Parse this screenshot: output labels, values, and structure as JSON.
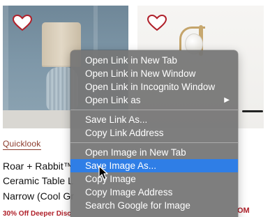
{
  "products": {
    "left": {
      "quicklook": "Quicklook",
      "title_lines": [
        "Roar + Rabbit™",
        "Ceramic Table L",
        "Narrow (Cool Gr"
      ],
      "promo": "30% Off Deeper Disc"
    },
    "right": {
      "promo_tail": "OM"
    }
  },
  "icons": {
    "left_favorite": "heart-icon",
    "right_favorite": "heart-icon",
    "submenu": "chevron-right-icon",
    "pointer": "arrow-cursor-icon"
  },
  "context_menu": {
    "groups": [
      {
        "items": [
          {
            "label": "Open Link in New Tab"
          },
          {
            "label": "Open Link in New Window"
          },
          {
            "label": "Open Link in Incognito Window"
          },
          {
            "label": "Open Link as",
            "submenu_glyph": "▶"
          }
        ]
      },
      {
        "items": [
          {
            "label": "Save Link As..."
          },
          {
            "label": "Copy Link Address"
          }
        ]
      },
      {
        "items": [
          {
            "label": "Open Image in New Tab"
          },
          {
            "label": "Save Image As...",
            "highlighted": true
          },
          {
            "label": "Copy Image"
          },
          {
            "label": "Copy Image Address"
          },
          {
            "label": "Search Google for Image"
          }
        ]
      }
    ]
  },
  "colors": {
    "heart": "#b0202a",
    "menu_highlight": "#2f7ee6",
    "promo": "#b0202a"
  }
}
